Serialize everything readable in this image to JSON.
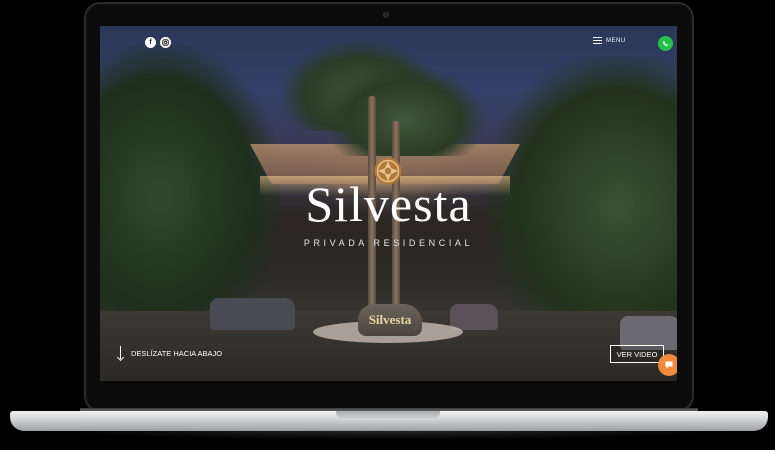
{
  "header": {
    "facebook_glyph": "f",
    "menu_label": "MENU"
  },
  "hero": {
    "brand": "Silvesta",
    "tagline": "PRIVADA RESIDENCIAL",
    "monument_text": "Silvesta"
  },
  "footer": {
    "scroll_hint": "DESLÍZATE HACIA ABAJO",
    "video_button": "VER VIDEO"
  },
  "colors": {
    "whatsapp": "#25c04a",
    "chat": "#f08a3c",
    "logo_ring": "#b07a3a"
  },
  "icons": [
    "facebook-icon",
    "instagram-icon",
    "hamburger-icon",
    "whatsapp-icon",
    "arrow-down-icon",
    "chat-icon",
    "logo-emblem-icon"
  ]
}
